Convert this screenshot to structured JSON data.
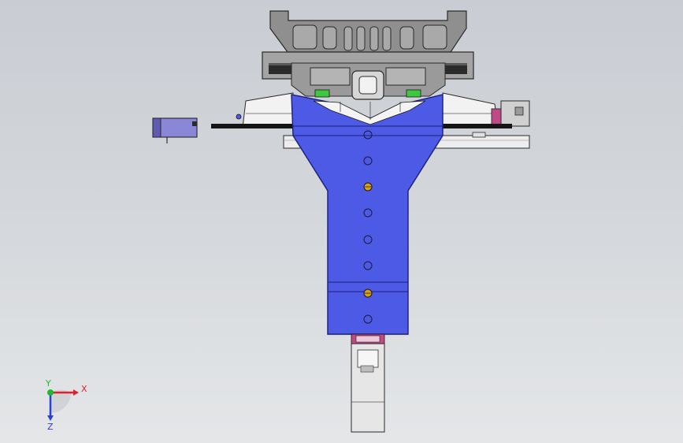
{
  "axes": {
    "x_label": "X",
    "y_label": "Y",
    "z_label": "Z",
    "x_color": "#e0202a",
    "y_color": "#1fb82a",
    "z_color": "#2a3ed8"
  },
  "colors": {
    "background_top": "#c9cdd3",
    "background_bottom": "#e4e6e8",
    "arm_body": "#4d5ae6",
    "arm_outline": "#1a1f7a",
    "frame_gray": "#8e8e8e",
    "plate_white": "#f2f2f2",
    "bolt_gold": "#d4a11c",
    "sensor_purple": "#8a87d6",
    "accent_green": "#3fc83f",
    "accent_pink": "#c04a86",
    "rail_black": "#151515"
  },
  "icons": {
    "triad": "axis-triad-icon"
  }
}
